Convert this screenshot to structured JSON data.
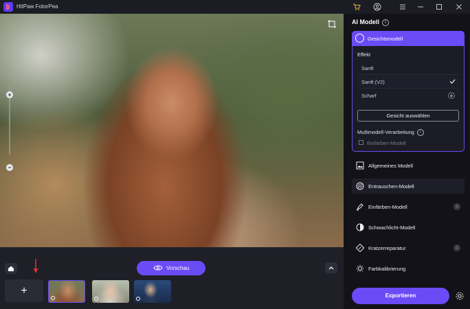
{
  "app": {
    "title": "HitPaw FotorPea"
  },
  "preview": {
    "label": "Vorschau"
  },
  "panel": {
    "title": "AI Modell",
    "face_model": {
      "label": "Gesichtsmodell",
      "effect_label": "Effekt",
      "options": [
        {
          "label": "Sanft",
          "selected": false
        },
        {
          "label": "Sanft (V2)",
          "selected": true
        },
        {
          "label": "Scharf",
          "selected": false
        }
      ],
      "choose_face": "Gesicht auswählen",
      "multimodel_label": "Multimodell-Verarbeitung",
      "colorize_checkbox_label": "Einfärben-Modell"
    },
    "models": [
      {
        "label": "Allgemeines Modell",
        "icon": "image-icon",
        "has_chevron": false
      },
      {
        "label": "Entrauschen-Modell",
        "icon": "denoise-icon",
        "has_chevron": false
      },
      {
        "label": "Einfärben-Modell",
        "icon": "colorize-icon",
        "has_chevron": true
      },
      {
        "label": "Schwachlicht-Modell",
        "icon": "lowlight-icon",
        "has_chevron": false
      },
      {
        "label": "Kratzerreparatur",
        "icon": "scratch-icon",
        "has_chevron": true
      },
      {
        "label": "Farbkalibrierung",
        "icon": "color-calibration-icon",
        "has_chevron": false
      }
    ],
    "export": "Exportieren"
  },
  "colors": {
    "accent": "#6a4cf6",
    "panel_bg": "#121218",
    "bottom_bg": "#1f1f28"
  }
}
